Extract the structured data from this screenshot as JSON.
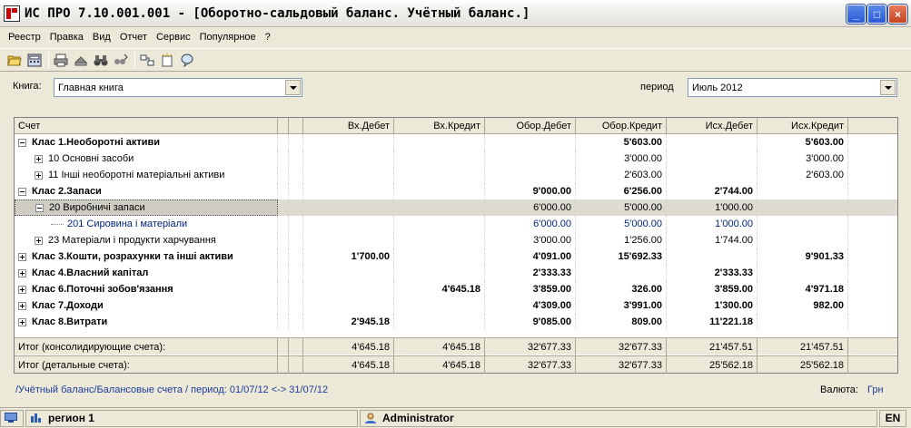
{
  "window": {
    "title": "ИС ПРО 7.10.001.001 - [Оборотно-сальдовый баланс. Учётный баланс.]",
    "minimize": "_",
    "maximize": "□",
    "close": "×"
  },
  "menu": [
    "Реестр",
    "Правка",
    "Вид",
    "Отчет",
    "Сервис",
    "Популярное",
    "?"
  ],
  "toolbar": {
    "icons": [
      "folder-open-icon",
      "calculator-icon",
      "print-icon",
      "export-icon",
      "binoculars-icon",
      "find-next-icon",
      "columns-icon",
      "new-item-icon",
      "comment-icon"
    ]
  },
  "filters": {
    "book_label": "Книга:",
    "book_value": "Главная книга",
    "period_label": "период",
    "period_value": "Июль 2012"
  },
  "grid": {
    "columns": [
      "Счет",
      "",
      "",
      "Вх.Дебет",
      "Вх.Кредит",
      "Обор.Дебет",
      "Обор.Кредит",
      "Исх.Дебет",
      "Исх.Кредит"
    ],
    "rows": [
      {
        "level": 0,
        "expander": "minus",
        "style": "bold",
        "account": "Клас 1.Необоротні активи",
        "vx_debit": "",
        "vx_credit": "",
        "obor_debit": "",
        "obor_credit": "5'603.00",
        "isx_debit": "",
        "isx_credit": "5'603.00"
      },
      {
        "level": 1,
        "expander": "plus",
        "style": "",
        "account": "10 Основні засоби",
        "vx_debit": "",
        "vx_credit": "",
        "obor_debit": "",
        "obor_credit": "3'000.00",
        "isx_debit": "",
        "isx_credit": "3'000.00"
      },
      {
        "level": 1,
        "expander": "plus",
        "style": "",
        "account": "11 Інші необоротні матеріальні активи",
        "vx_debit": "",
        "vx_credit": "",
        "obor_debit": "",
        "obor_credit": "2'603.00",
        "isx_debit": "",
        "isx_credit": "2'603.00"
      },
      {
        "level": 0,
        "expander": "minus",
        "style": "bold",
        "account": "Клас 2.Запаси",
        "vx_debit": "",
        "vx_credit": "",
        "obor_debit": "9'000.00",
        "obor_credit": "6'256.00",
        "isx_debit": "2'744.00",
        "isx_credit": ""
      },
      {
        "level": 1,
        "expander": "minus",
        "style": "sel",
        "account": "20 Виробничі запаси",
        "vx_debit": "",
        "vx_credit": "",
        "obor_debit": "6'000.00",
        "obor_credit": "5'000.00",
        "isx_debit": "1'000.00",
        "isx_credit": ""
      },
      {
        "level": 2,
        "expander": "leaf",
        "style": "blue",
        "account": "201 Сировина і матеріали",
        "vx_debit": "",
        "vx_credit": "",
        "obor_debit": "6'000.00",
        "obor_credit": "5'000.00",
        "isx_debit": "1'000.00",
        "isx_credit": ""
      },
      {
        "level": 1,
        "expander": "plus",
        "style": "",
        "account": "23 Матеріали і продукти харчування",
        "vx_debit": "",
        "vx_credit": "",
        "obor_debit": "3'000.00",
        "obor_credit": "1'256.00",
        "isx_debit": "1'744.00",
        "isx_credit": ""
      },
      {
        "level": 0,
        "expander": "plus",
        "style": "bold",
        "account": "Клас 3.Кошти, розрахунки та інші активи",
        "vx_debit": "1'700.00",
        "vx_credit": "",
        "obor_debit": "4'091.00",
        "obor_credit": "15'692.33",
        "isx_debit": "",
        "isx_credit": "9'901.33"
      },
      {
        "level": 0,
        "expander": "plus",
        "style": "bold",
        "account": "Клас 4.Власний капітал",
        "vx_debit": "",
        "vx_credit": "",
        "obor_debit": "2'333.33",
        "obor_credit": "",
        "isx_debit": "2'333.33",
        "isx_credit": ""
      },
      {
        "level": 0,
        "expander": "plus",
        "style": "bold",
        "account": "Клас 6.Поточні зобов'язання",
        "vx_debit": "",
        "vx_credit": "4'645.18",
        "obor_debit": "3'859.00",
        "obor_credit": "326.00",
        "isx_debit": "3'859.00",
        "isx_credit": "4'971.18"
      },
      {
        "level": 0,
        "expander": "plus",
        "style": "bold",
        "account": "Клас 7.Доходи",
        "vx_debit": "",
        "vx_credit": "",
        "obor_debit": "4'309.00",
        "obor_credit": "3'991.00",
        "isx_debit": "1'300.00",
        "isx_credit": "982.00"
      },
      {
        "level": 0,
        "expander": "plus",
        "style": "bold",
        "account": "Клас 8.Витрати",
        "vx_debit": "2'945.18",
        "vx_credit": "",
        "obor_debit": "9'085.00",
        "obor_credit": "809.00",
        "isx_debit": "11'221.18",
        "isx_credit": ""
      }
    ],
    "totals": [
      {
        "label": "Итог (консолидирующие счета):",
        "vx_debit": "4'645.18",
        "vx_credit": "4'645.18",
        "obor_debit": "32'677.33",
        "obor_credit": "32'677.33",
        "isx_debit": "21'457.51",
        "isx_credit": "21'457.51"
      },
      {
        "label": "Итог (детальные счета):",
        "vx_debit": "4'645.18",
        "vx_credit": "4'645.18",
        "obor_debit": "32'677.33",
        "obor_credit": "32'677.33",
        "isx_debit": "25'562.18",
        "isx_credit": "25'562.18"
      }
    ]
  },
  "footer": {
    "path": "/Учётный баланс/Балансовые счета / период: 01/07/12 <-> 31/07/12",
    "currency_label": "Валюта:",
    "currency_value": "Грн"
  },
  "statusbar": {
    "region": "регион 1",
    "user": "Administrator",
    "lang": "EN"
  }
}
